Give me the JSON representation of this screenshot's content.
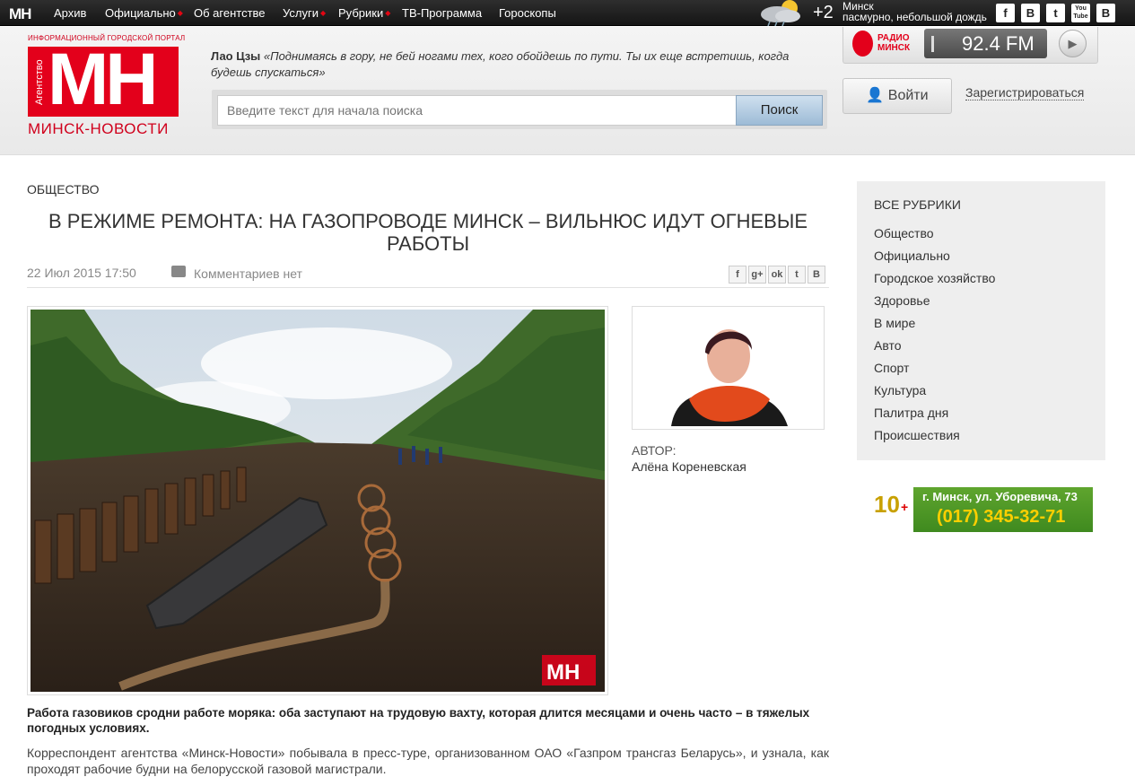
{
  "topnav": {
    "logo": "МН",
    "items": [
      "Архив",
      "Официально",
      "Об агентстве",
      "Услуги",
      "Рубрики",
      "ТВ-Программа",
      "Гороскопы"
    ]
  },
  "weather": {
    "temp": "+2",
    "city": "Минск",
    "desc": "пасмурно, небольшой дождь"
  },
  "social": [
    "f",
    "B",
    "t",
    "You Tube",
    "B"
  ],
  "header": {
    "tagline": "ИНФОРМАЦИОННЫЙ ГОРОДСКОЙ ПОРТАЛ",
    "logo_letters": "МН",
    "logo_vertical": "Агентство",
    "logo_name": "МИНСК-НОВОСТИ",
    "quote_author": "Лао Цзы",
    "quote_text": "«Поднимаясь в гору, не бей ногами тех, кого обойдешь по пути. Ты их еще встретишь, когда будешь спускаться»",
    "search_placeholder": "Введите текст для начала поиска",
    "search_button": "Поиск",
    "radio_line1": "РАДИО",
    "radio_line2": "МИНСК",
    "radio_freq": "92.4 FM",
    "login": "Войти",
    "register": "Зарегистрироваться"
  },
  "article": {
    "category": "ОБЩЕСТВО",
    "title": "В РЕЖИМЕ РЕМОНТА: НА ГАЗОПРОВОДЕ МИНСК – ВИЛЬНЮС ИДУТ ОГНЕВЫЕ РАБОТЫ",
    "date": "22 Июл 2015 17:50",
    "comments": "Комментариев нет",
    "share": [
      "f",
      "g+",
      "ok",
      "t",
      "B"
    ],
    "author_label": "АВТОР:",
    "author_name": "Алёна Кореневская",
    "lead": "Работа газовиков сродни работе моряка: оба заступают на трудовую вахту, которая длится месяцами и очень часто – в тяжелых погодных условиях.",
    "body": "Корреспондент агентства «Минск-Новости» побывала в пресс-туре, организованном ОАО «Газпром трансгаз Беларусь», и узнала, как проходят рабочие будни на белорусской газовой магистрали."
  },
  "sidebar": {
    "heading": "ВСЕ РУБРИКИ",
    "items": [
      "Общество",
      "Официально",
      "Городское хозяйство",
      "Здоровье",
      "В мире",
      "Авто",
      "Спорт",
      "Культура",
      "Палитра дня",
      "Происшествия"
    ]
  },
  "ad": {
    "address": "г. Минск, ул. Уборевича, 73",
    "phone": "(017) 345-32-71",
    "logo_text": "10"
  }
}
